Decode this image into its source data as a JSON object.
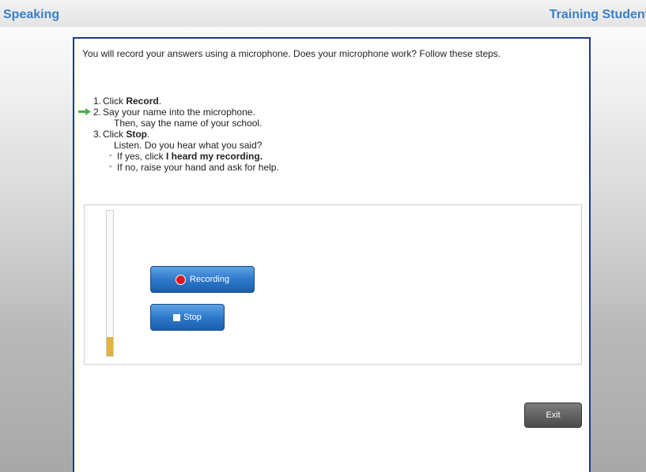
{
  "header": {
    "section_title": "Speaking",
    "student_name": "Training Student"
  },
  "instructions": {
    "intro": "You will record your answers using a microphone. Does your microphone work? Follow these steps.",
    "step1_num": "1.",
    "step1_prefix": "Click ",
    "step1_bold": "Record",
    "step1_suffix": ".",
    "step2_num": "2.",
    "step2_line1": "Say your name into the microphone.",
    "step2_line2": "Then, say the name of your school.",
    "step3_num": "3.",
    "step3_prefix": "Click ",
    "step3_bold": "Stop",
    "step3_suffix": ".",
    "step3_line2": "Listen. Do you hear what you said?",
    "bullet1_prefix": "If yes, click ",
    "bullet1_bold": "I heard my recording.",
    "bullet2": "If no, raise your hand and ask for help.",
    "current_step_arrow_color": "#4caf50"
  },
  "recorder": {
    "record_label": "Recording",
    "stop_label": "Stop",
    "level_fraction": 0.13,
    "level_color": "#e1b33c"
  },
  "footer": {
    "exit_label": "Exit"
  }
}
